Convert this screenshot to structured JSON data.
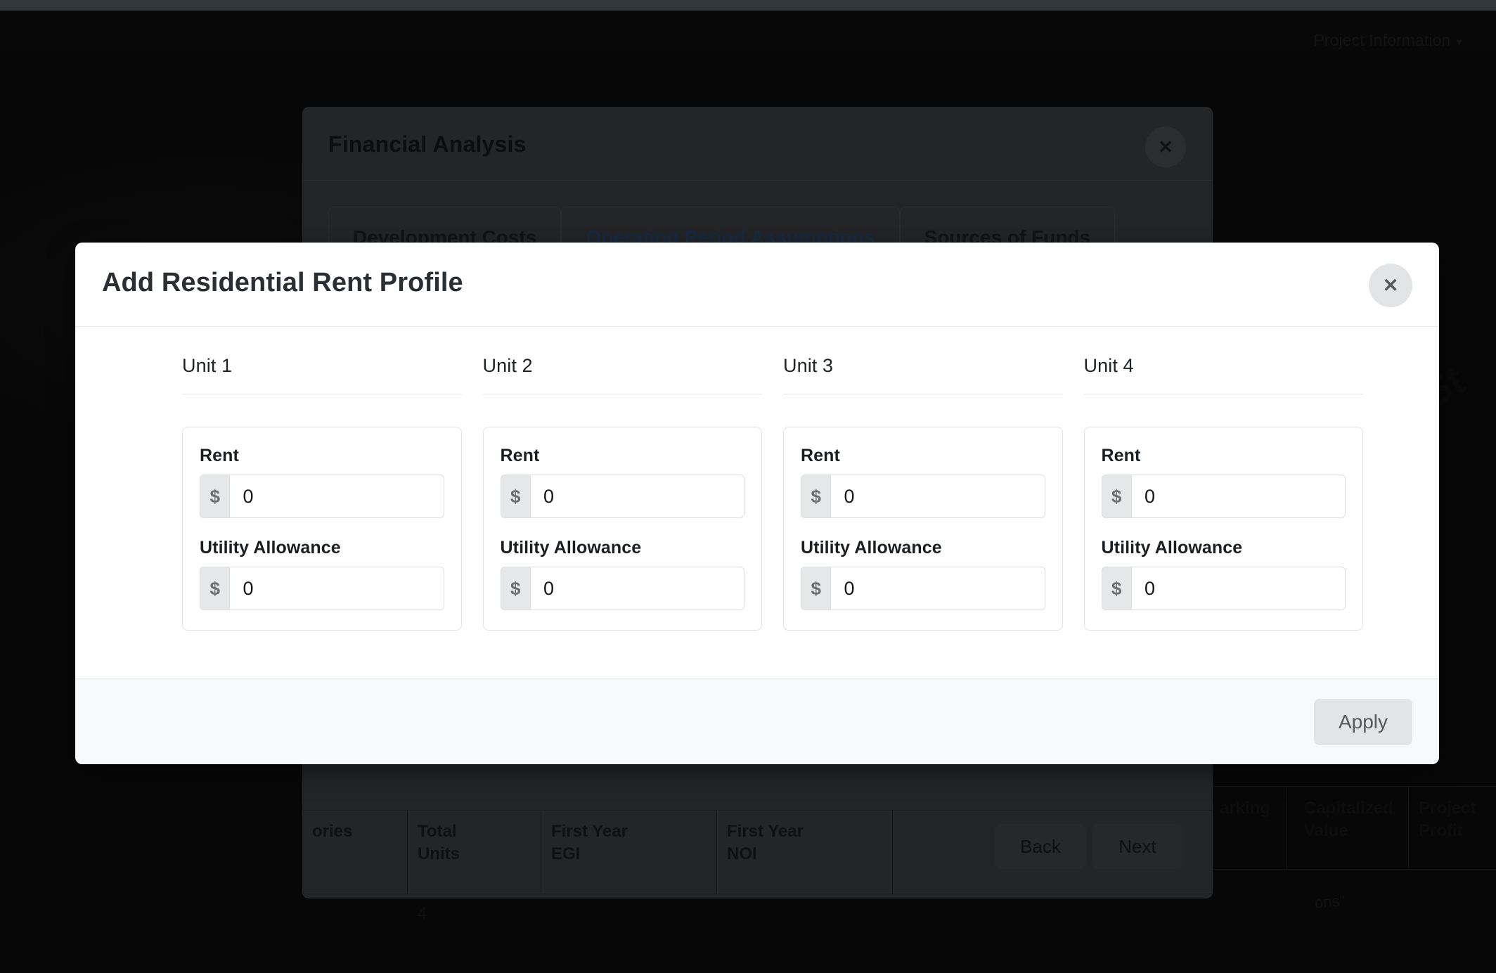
{
  "background": {
    "nav": {
      "project_information_label": "Project Information",
      "caret_icon": "chevron-down-icon"
    },
    "modal": {
      "title": "Financial Analysis",
      "close_icon": "close-icon",
      "tabs": [
        {
          "label": "Development Costs",
          "active": false
        },
        {
          "label": "Operating Period Assumptions",
          "active": true
        },
        {
          "label": "Sources of Funds",
          "active": false
        }
      ],
      "table": {
        "headers": [
          "ories",
          "Total\nUnits",
          "First Year\nEGI",
          "First Year\nNOI"
        ],
        "row": [
          "",
          "4",
          "",
          ""
        ]
      },
      "buttons": {
        "back": "Back",
        "next": "Next"
      }
    },
    "outer_table": {
      "headers": [
        "arking",
        "Capitalized\nValue",
        "Project\nProfit"
      ]
    },
    "quote_text": "ons\""
  },
  "dialog": {
    "title": "Add Residential Rent Profile",
    "close_icon": "close-icon",
    "currency_symbol": "$",
    "labels": {
      "rent": "Rent",
      "utility_allowance": "Utility Allowance"
    },
    "units": [
      {
        "name": "Unit 1",
        "rent": "0",
        "utility_allowance": "0"
      },
      {
        "name": "Unit 2",
        "rent": "0",
        "utility_allowance": "0"
      },
      {
        "name": "Unit 3",
        "rent": "0",
        "utility_allowance": "0"
      },
      {
        "name": "Unit 4",
        "rent": "0",
        "utility_allowance": "0"
      }
    ],
    "footer": {
      "apply_label": "Apply"
    }
  },
  "colors": {
    "dialog_bg": "#ffffff",
    "footer_bg": "#f8f9fa",
    "addon_bg": "#e6e7e9",
    "button_bg": "#e2e4e6",
    "active_tab": "#182a42",
    "border": "#e1e3e5"
  }
}
